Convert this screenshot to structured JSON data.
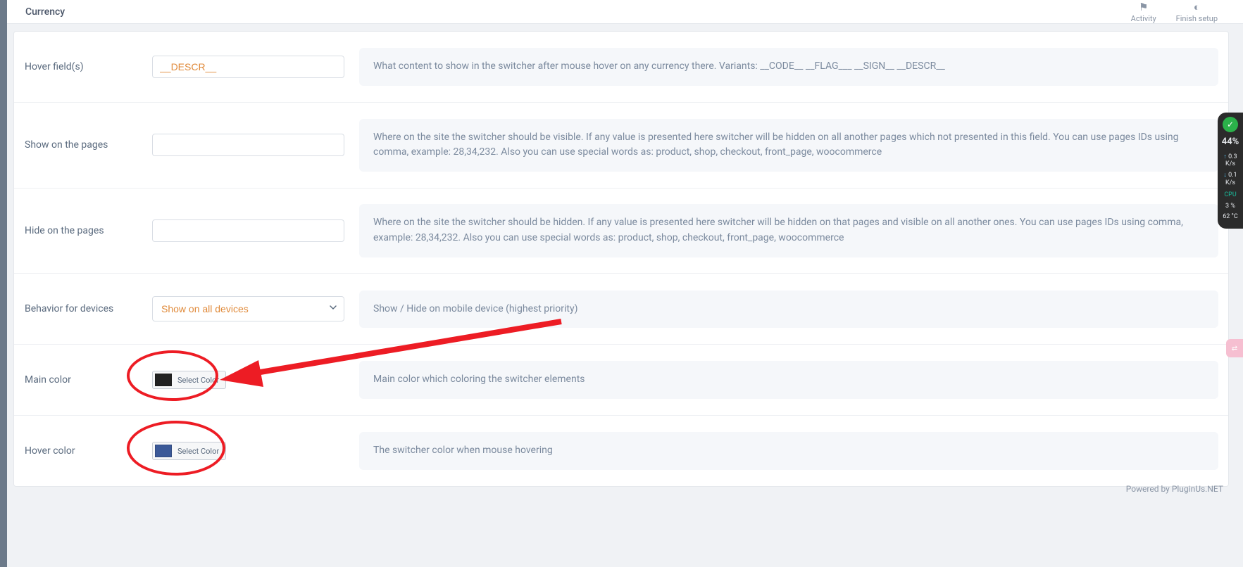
{
  "header": {
    "title": "Currency",
    "actions": {
      "activity": "Activity",
      "finish_setup": "Finish setup"
    }
  },
  "rows": {
    "hover_fields": {
      "label": "Hover field(s)",
      "value": "__DESCR__",
      "desc": "What content to show in the switcher after mouse hover on any currency there. Variants: __CODE__ __FLAG___ __SIGN__ __DESCR__"
    },
    "show_pages": {
      "label": "Show on the pages",
      "value": "",
      "desc": "Where on the site the switcher should be visible. If any value is presented here switcher will be hidden on all another pages which not presented in this field. You can use pages IDs using comma, example: 28,34,232. Also you can use special words as: product, shop, checkout, front_page, woocommerce"
    },
    "hide_pages": {
      "label": "Hide on the pages",
      "value": "",
      "desc": "Where on the site the switcher should be hidden. If any value is presented here switcher will be hidden on that pages and visible on all another ones. You can use pages IDs using comma, example: 28,34,232. Also you can use special words as: product, shop, checkout, front_page, woocommerce"
    },
    "behavior": {
      "label": "Behavior for devices",
      "selected": "Show on all devices",
      "desc": "Show / Hide on mobile device (highest priority)"
    },
    "main_color": {
      "label": "Main color",
      "button": "Select Color",
      "swatch": "#222222",
      "desc": "Main color which coloring the switcher elements"
    },
    "hover_color": {
      "label": "Hover color",
      "button": "Select Color",
      "swatch": "#3b5998",
      "desc": "The switcher color when mouse hovering"
    }
  },
  "footer": {
    "powered": "Powered by PluginUs.NET"
  },
  "sys": {
    "pct": "44%",
    "up": "0.3",
    "up_unit": "K/s",
    "down": "0.1",
    "down_unit": "K/s",
    "cpu_label": "CPU",
    "cpu_pct": "3  %",
    "temp": "62 °C"
  }
}
